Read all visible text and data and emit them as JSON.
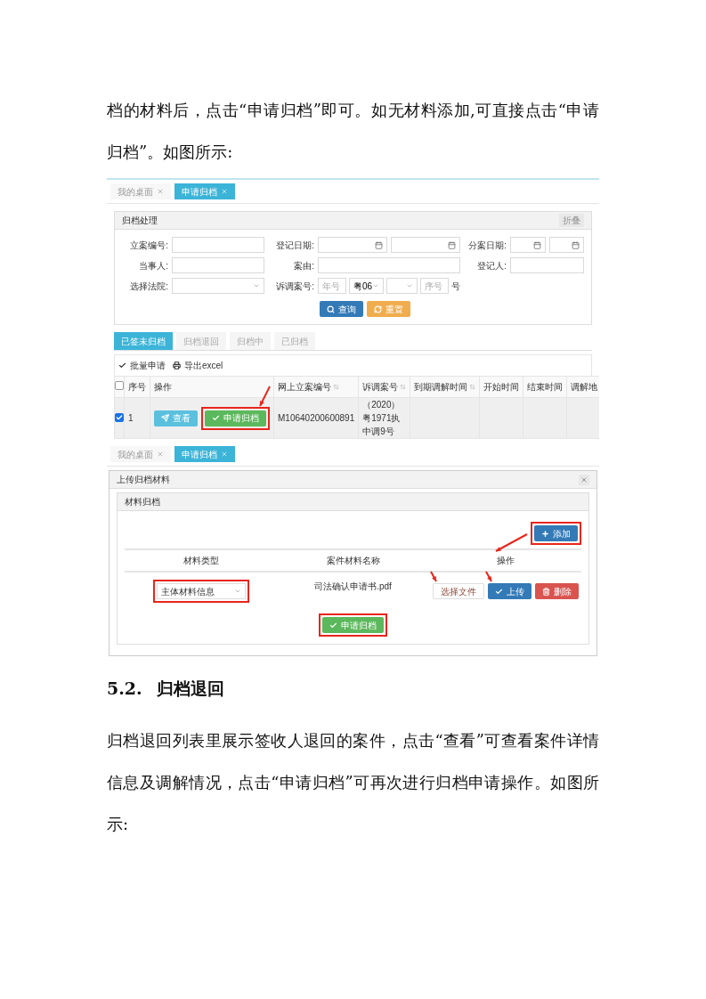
{
  "intro": "档的材料后，点击“申请归档”即可。如无材料添加,可直接点击“申请归档”。如图所示:",
  "screenshot_list": {
    "tabs": [
      {
        "label": "我的桌面",
        "selected": false
      },
      {
        "label": "申请归档",
        "selected": true
      }
    ],
    "panel": {
      "title": "归档处理",
      "collapse": "折叠",
      "fields": [
        {
          "label": "立案编号:",
          "kind": "text"
        },
        {
          "label": "登记日期:",
          "kind": "date_range"
        },
        {
          "label": "分案日期:",
          "kind": "date_range"
        },
        {
          "label": "当事人:",
          "kind": "text"
        },
        {
          "label": "案由:",
          "kind": "text"
        },
        {
          "label": "登记人:",
          "kind": "text"
        },
        {
          "label": "选择法院:",
          "kind": "select"
        },
        {
          "label": "诉调案号:",
          "kind": "case_number",
          "parts": [
            {
              "kind": "input",
              "placeholder": "年号"
            },
            {
              "kind": "select",
              "value": "粤06"
            },
            {
              "kind": "select"
            },
            {
              "kind": "input",
              "placeholder": "序号"
            },
            {
              "kind": "suffix",
              "text": "号"
            }
          ]
        }
      ],
      "buttons": [
        {
          "label": "查询",
          "kind": "search"
        },
        {
          "label": "重置",
          "kind": "reset"
        }
      ]
    },
    "status_tabs": [
      {
        "label": "已签未归档",
        "selected": true
      },
      {
        "label": "归档退回",
        "selected": false
      },
      {
        "label": "归档中",
        "selected": false
      },
      {
        "label": "已归档",
        "selected": false
      }
    ],
    "toolbar": [
      {
        "label": "批量申请",
        "kind": "check"
      },
      {
        "label": "导出excel",
        "kind": "print"
      }
    ],
    "table": {
      "header_checked": false,
      "columns": [
        {
          "label": "序号",
          "sortable": false
        },
        {
          "label": "操作",
          "sortable": false
        },
        {
          "label": "网上立案编号",
          "sortable": true
        },
        {
          "label": "诉调案号",
          "sortable": true
        },
        {
          "label": "到期调解时间",
          "sortable": true
        },
        {
          "label": "开始时间",
          "sortable": false
        },
        {
          "label": "结束时间",
          "sortable": false
        },
        {
          "label": "调解地",
          "sortable": false
        }
      ],
      "rows": [
        {
          "checked": true,
          "index": "1",
          "actions": [
            {
              "label": "查看",
              "kind": "view",
              "highlighted": false
            },
            {
              "label": "申请归档",
              "kind": "apply",
              "highlighted": true
            }
          ],
          "online_case_number": "M10640200600891",
          "mediation_case_number": "（2020）粤1971执中调9号"
        }
      ]
    }
  },
  "screenshot_upload": {
    "tabs": [
      {
        "label": "我的桌面",
        "selected": false
      },
      {
        "label": "申请归档",
        "selected": true
      }
    ],
    "dialog_title": "上传归档材料",
    "section_title": "材料归档",
    "add_button": {
      "label": "添加",
      "highlighted": true
    },
    "columns": [
      "材料类型",
      "案件材料名称",
      "操作"
    ],
    "rows": [
      {
        "type": "主体材料信息",
        "type_highlighted": true,
        "file": "司法确认申请书.pdf",
        "actions": [
          {
            "label": "选择文件",
            "kind": "choose",
            "pointed": true
          },
          {
            "label": "上传",
            "kind": "upload",
            "pointed": true
          },
          {
            "label": "删除",
            "kind": "delete",
            "pointed": false
          }
        ]
      }
    ],
    "submit": {
      "label": "申请归档",
      "highlighted": true
    }
  },
  "section": {
    "number": "5.2.",
    "title": "归档退回"
  },
  "body": "归档退回列表里展示签收人退回的案件，点击“查看”可查看案件详情信息及调解情况，点击“申请归档”可再次进行归档申请操作。如图所示:"
}
